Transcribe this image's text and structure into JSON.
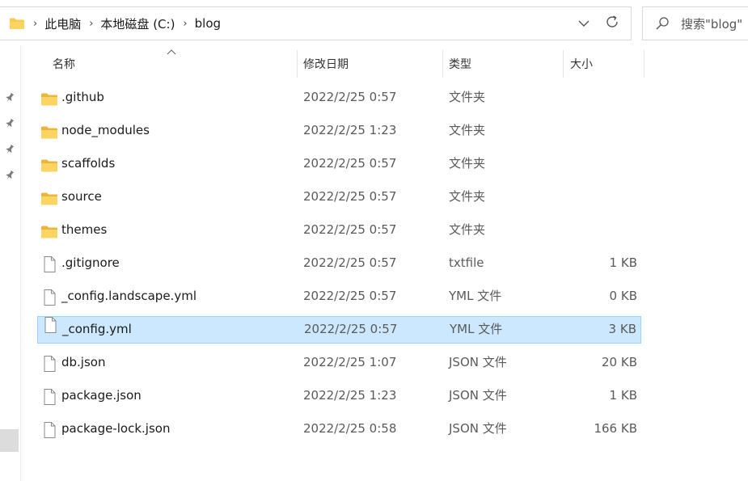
{
  "address_bar": {
    "breadcrumbs": [
      "此电脑",
      "本地磁盘 (C:)",
      "blog"
    ]
  },
  "search": {
    "placeholder": "搜索\"blog\""
  },
  "columns": {
    "name": "名称",
    "date": "修改日期",
    "type": "类型",
    "size": "大小"
  },
  "files": [
    {
      "name": ".github",
      "date": "2022/2/25 0:57",
      "type": "文件夹",
      "size": "",
      "icon": "folder-icon"
    },
    {
      "name": "node_modules",
      "date": "2022/2/25 1:23",
      "type": "文件夹",
      "size": "",
      "icon": "folder-icon"
    },
    {
      "name": "scaffolds",
      "date": "2022/2/25 0:57",
      "type": "文件夹",
      "size": "",
      "icon": "folder-icon"
    },
    {
      "name": "source",
      "date": "2022/2/25 0:57",
      "type": "文件夹",
      "size": "",
      "icon": "folder-icon"
    },
    {
      "name": "themes",
      "date": "2022/2/25 0:57",
      "type": "文件夹",
      "size": "",
      "icon": "folder-icon"
    },
    {
      "name": ".gitignore",
      "date": "2022/2/25 0:57",
      "type": "txtfile",
      "size": "1 KB",
      "icon": "file-icon"
    },
    {
      "name": "_config.landscape.yml",
      "date": "2022/2/25 0:57",
      "type": "YML 文件",
      "size": "0 KB",
      "icon": "file-icon"
    },
    {
      "name": "_config.yml",
      "date": "2022/2/25 0:57",
      "type": "YML 文件",
      "size": "3 KB",
      "icon": "file-icon",
      "selected": true
    },
    {
      "name": "db.json",
      "date": "2022/2/25 1:07",
      "type": "JSON 文件",
      "size": "20 KB",
      "icon": "file-icon"
    },
    {
      "name": "package.json",
      "date": "2022/2/25 1:23",
      "type": "JSON 文件",
      "size": "1 KB",
      "icon": "file-icon"
    },
    {
      "name": "package-lock.json",
      "date": "2022/2/25 0:58",
      "type": "JSON 文件",
      "size": "166 KB",
      "icon": "file-icon"
    }
  ],
  "colors": {
    "selection_bg": "#cce8ff",
    "selection_border": "#99d1ff",
    "folder": "#f8c94a"
  }
}
